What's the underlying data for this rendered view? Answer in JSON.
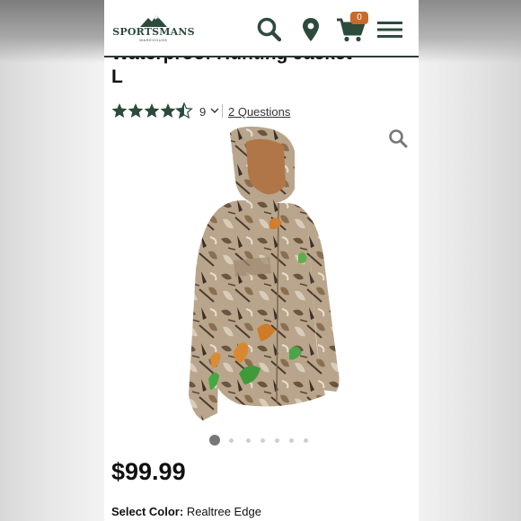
{
  "header": {
    "logo_text": "SPORTSMANS",
    "logo_sub": "WAREHOUSE",
    "cart_count": "0"
  },
  "product": {
    "title_line1": "Waterproof Hunting Jacket",
    "title_line2": "L",
    "rating_count": "9",
    "rating_value": 4.5,
    "questions_link": "2 Questions",
    "price": "$99.99",
    "color_label": "Select Color:",
    "color_value": "Realtree Edge"
  },
  "carousel": {
    "dot_count": 7,
    "active_index": 0
  },
  "colors": {
    "brand_green": "#2d4b3b",
    "accent_orange": "#c76a2a"
  }
}
